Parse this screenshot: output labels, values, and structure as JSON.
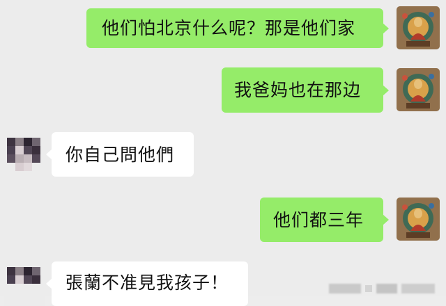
{
  "messages": [
    {
      "side": "sent",
      "text": "他们怕北京什么呢？那是他们家"
    },
    {
      "side": "sent",
      "text": "我爸妈也在那边"
    },
    {
      "side": "received",
      "text": "你自己問他們"
    },
    {
      "side": "sent",
      "text": "他们都三年"
    },
    {
      "side": "received",
      "text": "張蘭不准見我孩子！"
    }
  ],
  "colors": {
    "background": "#ececec",
    "sent_bubble": "#95ec69",
    "received_bubble": "#ffffff"
  },
  "icons": {
    "self_avatar": "buddha-thangka-avatar",
    "other_avatar": "pixelated-avatar"
  }
}
